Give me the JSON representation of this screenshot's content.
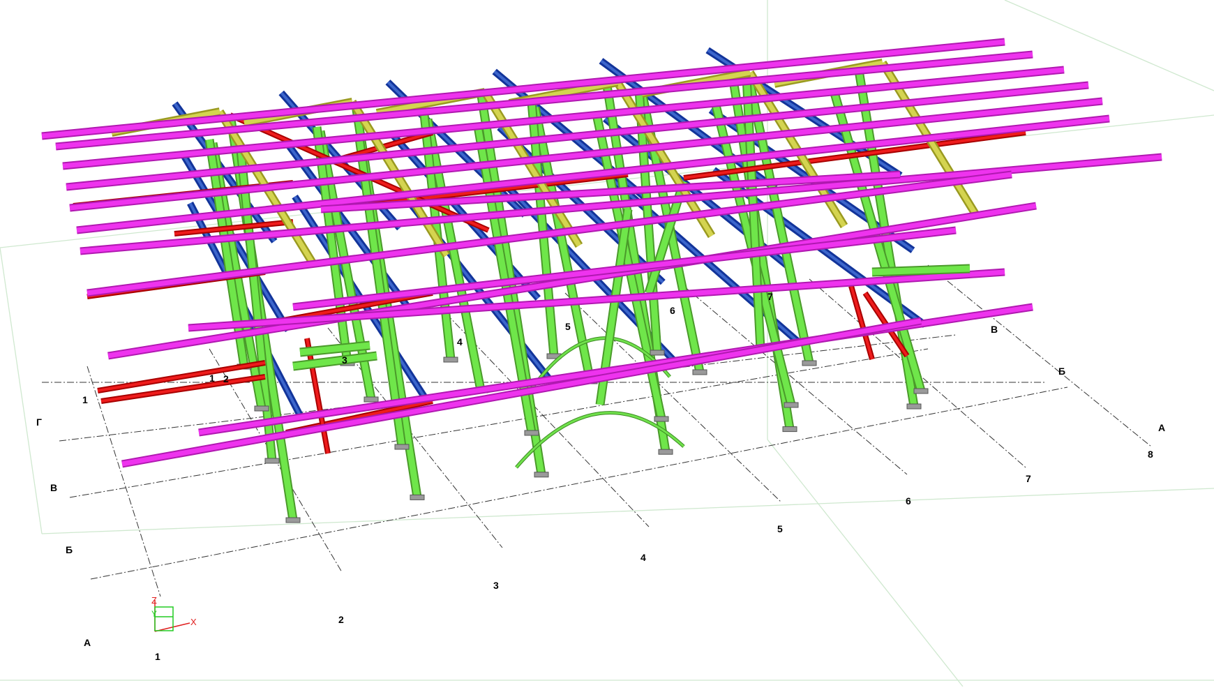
{
  "axes_letters": {
    "front": [
      "Г",
      "В",
      "Б",
      "А"
    ],
    "back": [
      "В",
      "Б",
      "А"
    ]
  },
  "axes_numbers": {
    "front": [
      "1",
      "2",
      "3",
      "4",
      "5",
      "6",
      "7",
      "8"
    ],
    "back": [
      "1",
      "2",
      "3",
      "4",
      "5",
      "6",
      "7"
    ],
    "bottom": "1"
  },
  "ucs": {
    "x": "X",
    "y": "Y",
    "z": "Z"
  },
  "colors": {
    "columns": "#6fe64a",
    "girders": "#3c66cc",
    "purlins": "#ee33ee",
    "bracing": "#ee1c1c",
    "trusses": "#d4d450",
    "grid": "#333333"
  }
}
